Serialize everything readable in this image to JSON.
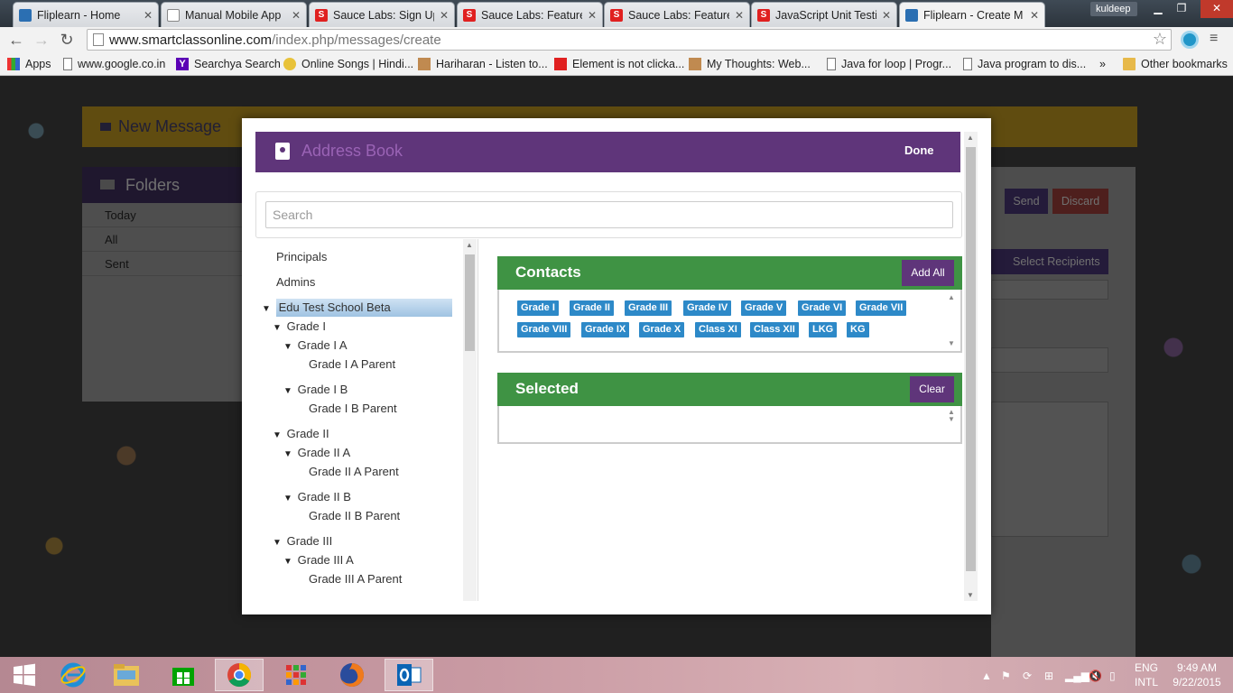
{
  "browser": {
    "tabs": [
      {
        "title": "Fliplearn - Home",
        "icon": "fliplearn-favicon"
      },
      {
        "title": "Manual Mobile App",
        "icon": "document-favicon"
      },
      {
        "title": "Sauce Labs: Sign Up",
        "icon": "sauce-labs-favicon"
      },
      {
        "title": "Sauce Labs: Features",
        "icon": "sauce-labs-favicon"
      },
      {
        "title": "Sauce Labs: Features",
        "icon": "sauce-labs-favicon"
      },
      {
        "title": "JavaScript Unit Testin",
        "icon": "sauce-labs-favicon"
      },
      {
        "title": "Fliplearn - Create M",
        "icon": "fliplearn-favicon",
        "active": true
      }
    ],
    "profile_name": "kuldeep",
    "url_host": "www.smartclassonline.com",
    "url_path": "/index.php/messages/create",
    "bookmarks": [
      "Apps",
      "www.google.co.in",
      "Searchya Search",
      "Online Songs | Hindi...",
      "Hariharan - Listen to...",
      "Element is not clicka...",
      "My Thoughts: Web...",
      "Java for loop | Progr...",
      "Java program to dis...",
      "»",
      "Other bookmarks"
    ]
  },
  "background_page": {
    "new_message_title": "New Message",
    "folders_title": "Folders",
    "folders": [
      "Today",
      "All",
      "Sent"
    ],
    "send_label": "Send",
    "discard_label": "Discard",
    "select_recipients_label": "Select Recipients"
  },
  "modal": {
    "title": "Address Book",
    "done_label": "Done",
    "search_placeholder": "Search",
    "tree": [
      {
        "label": "Principals",
        "level": 0,
        "arrow": false
      },
      {
        "label": "Admins",
        "level": 0,
        "arrow": false
      },
      {
        "label": "Edu Test School Beta",
        "level": 0,
        "arrow": true,
        "selected": true
      },
      {
        "label": "Grade I",
        "level": 1,
        "arrow": true
      },
      {
        "label": "Grade I A",
        "level": 2,
        "arrow": true
      },
      {
        "label": "Grade I A Parent",
        "level": 3,
        "arrow": false
      },
      {
        "label": "Grade I B",
        "level": 2,
        "arrow": true
      },
      {
        "label": "Grade I B Parent",
        "level": 3,
        "arrow": false
      },
      {
        "label": "Grade II",
        "level": 1,
        "arrow": true
      },
      {
        "label": "Grade II A",
        "level": 2,
        "arrow": true
      },
      {
        "label": "Grade II A Parent",
        "level": 3,
        "arrow": false
      },
      {
        "label": "Grade II B",
        "level": 2,
        "arrow": true
      },
      {
        "label": "Grade II B Parent",
        "level": 3,
        "arrow": false
      },
      {
        "label": "Grade III",
        "level": 1,
        "arrow": true
      },
      {
        "label": "Grade III A",
        "level": 2,
        "arrow": true
      },
      {
        "label": "Grade III A Parent",
        "level": 3,
        "arrow": false
      }
    ],
    "contacts_title": "Contacts",
    "add_all_label": "Add All",
    "contact_chips": [
      "Grade I",
      "Grade II",
      "Grade III",
      "Grade IV",
      "Grade V",
      "Grade VI",
      "Grade VII",
      "Grade VIII",
      "Grade IX",
      "Grade X",
      "Class XI",
      "Class XII",
      "LKG",
      "KG"
    ],
    "selected_title": "Selected",
    "clear_label": "Clear"
  },
  "taskbar": {
    "apps": [
      "start-button",
      "internet-explorer",
      "file-explorer",
      "windows-store",
      "chrome",
      "apps-grid",
      "firefox",
      "outlook"
    ],
    "lang_line1": "ENG",
    "lang_line2": "INTL",
    "time": "9:49 AM",
    "date": "9/22/2015"
  },
  "colors": {
    "purple": "#5f357a",
    "green": "#3f9344",
    "chip_blue": "#2d89c8"
  }
}
